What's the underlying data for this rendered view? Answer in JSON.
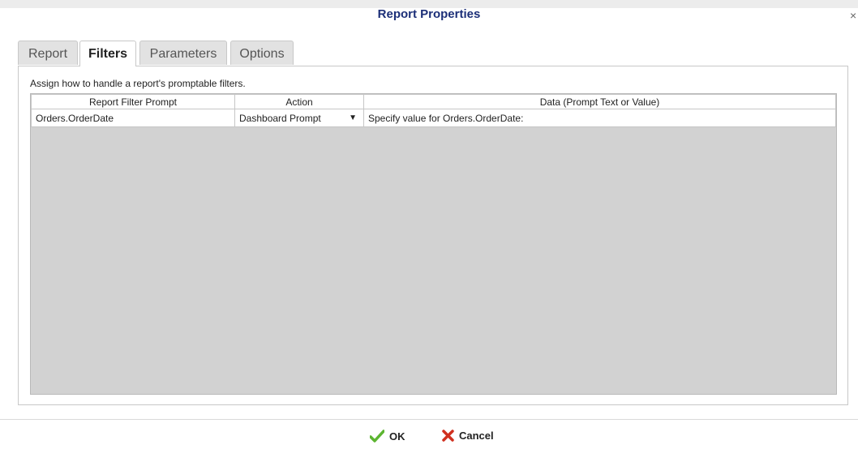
{
  "dialog": {
    "title": "Report Properties",
    "close_glyph": "×"
  },
  "tabs": [
    {
      "label": "Report"
    },
    {
      "label": "Filters"
    },
    {
      "label": "Parameters"
    },
    {
      "label": "Options"
    }
  ],
  "active_tab": "Filters",
  "filters": {
    "hint": "Assign how to handle a report's promptable filters.",
    "columns": [
      "Report Filter Prompt",
      "Action",
      "Data (Prompt Text or Value)"
    ],
    "rows": [
      {
        "prompt": "Orders.OrderDate",
        "action": "Dashboard Prompt",
        "data": "Specify value for Orders.OrderDate:"
      }
    ]
  },
  "buttons": {
    "ok": "OK",
    "cancel": "Cancel"
  },
  "icons": {
    "ok": "checkmark-icon",
    "cancel": "x-mark-icon",
    "dropdown": "triangle-down-icon",
    "close": "close-icon"
  },
  "colors": {
    "title": "#1c2f78",
    "ok_icon": "#5cb531",
    "cancel_icon": "#d0301f",
    "grid_bg": "#d2d2d2"
  }
}
